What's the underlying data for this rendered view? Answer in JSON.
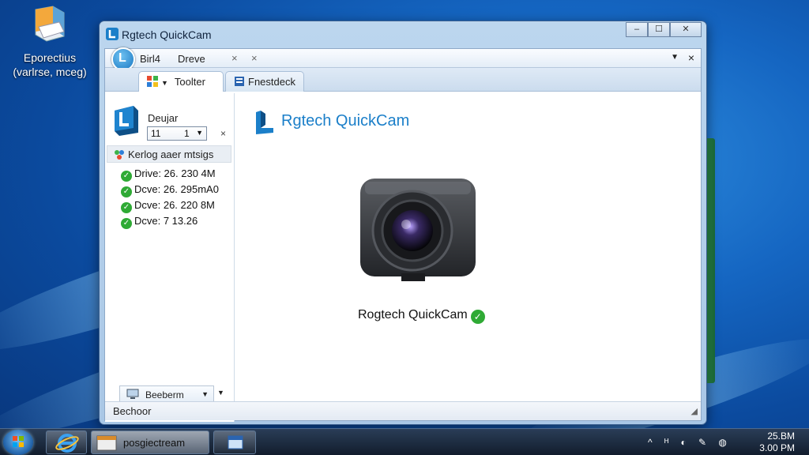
{
  "desktop": {
    "icon_label_line1": "Eporectius",
    "icon_label_line2": "(varlrse, mceg)"
  },
  "window": {
    "title": "Rgtech QuickCam",
    "controls": {
      "minimize": "–",
      "maximize": "☐",
      "close": "✕"
    }
  },
  "addressbar": {
    "item1": "Birl4",
    "item2": "Dreve",
    "close_a": "×",
    "close_b": "×",
    "dropdown": "▼",
    "close": "×"
  },
  "tabs": [
    {
      "label": "Toolter"
    },
    {
      "label": "Fnestdeck"
    }
  ],
  "sidebar": {
    "device_name": "Deujar",
    "select_value_a": "11",
    "select_value_b": "1",
    "select_close": "×",
    "group_label": "Kerlog aaer mtsigs",
    "drives": [
      {
        "label": "Drive: 26. 230 4M"
      },
      {
        "label": "Dcve: 26. 295mA0"
      },
      {
        "label": "Dcve: 26. 220 8M"
      },
      {
        "label": "Dcve: 7 13.26"
      }
    ],
    "footer_button": "Beeberm",
    "footer_arrow": "▼"
  },
  "main": {
    "brand_title": "Rgtech QuickCam",
    "caption": "Rogtech QuickCam",
    "status_check": "✓"
  },
  "statusbar": {
    "text": "Bechoor"
  },
  "taskbar": {
    "active_app": "posgiectream",
    "clock_line1": "25.BM",
    "clock_line2": "3.00 PM",
    "tray_icons": "^ ᴴ ◐ ✎ ◍"
  },
  "colors": {
    "brand_blue": "#1b7fc9",
    "ok_green": "#2faa35"
  }
}
